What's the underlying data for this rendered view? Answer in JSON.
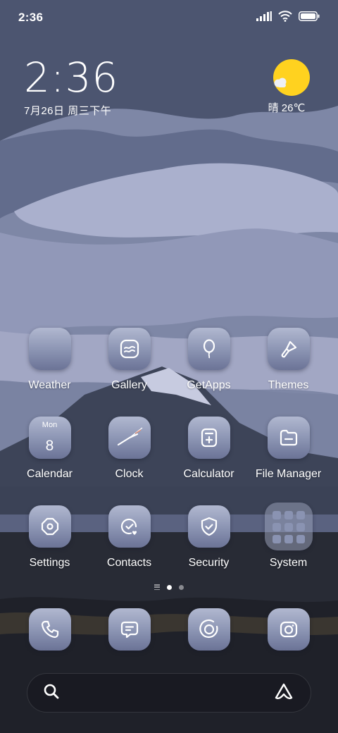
{
  "status_bar": {
    "time": "2:36",
    "icons": [
      "signal-icon",
      "wifi-icon",
      "battery-icon"
    ]
  },
  "clock_widget": {
    "time": "2:36",
    "date": "7月26日 周三下午"
  },
  "weather_widget": {
    "icon": "sun-with-cloud-icon",
    "text": "晴 26℃"
  },
  "apps": {
    "row1": [
      {
        "label": "Weather",
        "icon": "weather-icon"
      },
      {
        "label": "Gallery",
        "icon": "gallery-icon"
      },
      {
        "label": "GetApps",
        "icon": "balloon-icon"
      },
      {
        "label": "Themes",
        "icon": "brush-icon"
      }
    ],
    "row2": [
      {
        "label": "Calendar",
        "icon": "calendar-icon",
        "day": "Mon",
        "date": "8"
      },
      {
        "label": "Clock",
        "icon": "clock-icon"
      },
      {
        "label": "Calculator",
        "icon": "calculator-icon"
      },
      {
        "label": "File Manager",
        "icon": "folder-icon"
      }
    ],
    "row3": [
      {
        "label": "Settings",
        "icon": "gear-icon"
      },
      {
        "label": "Contacts",
        "icon": "contacts-icon"
      },
      {
        "label": "Security",
        "icon": "shield-icon"
      },
      {
        "label": "System",
        "icon": "folder-group-icon"
      }
    ]
  },
  "page_indicator": {
    "pages": 3,
    "active_index": 1
  },
  "dock": [
    "phone-icon",
    "message-icon",
    "browser-icon",
    "camera-icon"
  ],
  "search_bar": {
    "icons": [
      "search-icon",
      "assistant-icon"
    ]
  },
  "colors": {
    "accent_sun": "#ffd21f",
    "icon_gradient_top": "#b1b8d0",
    "icon_gradient_bottom": "#6b7396"
  }
}
